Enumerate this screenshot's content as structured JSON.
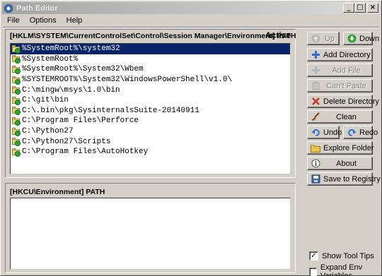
{
  "window": {
    "title": "Path Editor"
  },
  "titlebar_controls": {
    "minimize": "_",
    "maximize": "□",
    "close": "×"
  },
  "menu": [
    "File",
    "Options",
    "Help"
  ],
  "system_panel": {
    "header": "[HKLM\\SYSTEM\\CurrentControlSet\\Control\\Session Manager\\Environment] PATH",
    "active_label": "Active",
    "items": [
      "%SystemRoot%\\system32",
      "%SystemRoot%",
      "%SystemRoot%\\System32\\Wbem",
      "%SYSTEMROOT%\\System32\\WindowsPowerShell\\v1.0\\",
      "C:\\mingw\\msys\\1.0\\bin",
      "C:\\git\\bin",
      "C:\\.bin\\pkg\\SysinternalsSuite-20140911",
      "C:\\Program Files\\Perforce",
      "C:\\Python27",
      "C:\\Python27\\Scripts",
      "C:\\Program Files\\AutoHotkey"
    ],
    "selected_index": 0
  },
  "user_panel": {
    "header": "[HKCU\\Environment] PATH",
    "items": []
  },
  "buttons": {
    "up": "Up",
    "down": "Down",
    "add_directory": "Add Directory",
    "add_file": "Add File",
    "cant_paste": "Can't Paste",
    "delete_directory": "Delete Directory",
    "clean": "Clean",
    "undo": "Undo",
    "redo": "Redo",
    "explore_folder": "Explore Folder",
    "about": "About",
    "save_to_registry": "Save to Registry"
  },
  "checkboxes": {
    "show_tool_tips": {
      "label": "Show Tool Tips",
      "checked": true
    },
    "expand_env_variables": {
      "label": "Expand Env Variables",
      "checked": false
    }
  },
  "colors": {
    "selection": "#0a246a",
    "window_bg": "#d4d0c8",
    "ok_green": "#2fa32f",
    "add_blue": "#2b6fd6",
    "delete_red": "#c0392b"
  }
}
